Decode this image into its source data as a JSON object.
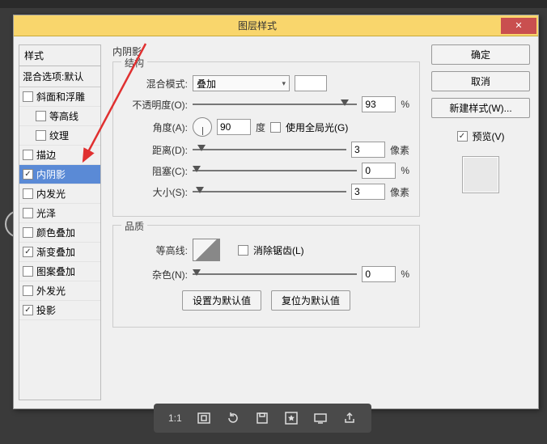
{
  "window": {
    "title": "图层样式"
  },
  "sidebar": {
    "header": "样式",
    "blend": "混合选项:默认",
    "items": [
      {
        "label": "斜面和浮雕",
        "checked": false,
        "indent": false
      },
      {
        "label": "等高线",
        "checked": false,
        "indent": true
      },
      {
        "label": "纹理",
        "checked": false,
        "indent": true
      },
      {
        "label": "描边",
        "checked": false,
        "indent": false
      },
      {
        "label": "内阴影",
        "checked": true,
        "indent": false,
        "selected": true
      },
      {
        "label": "内发光",
        "checked": false,
        "indent": false
      },
      {
        "label": "光泽",
        "checked": false,
        "indent": false
      },
      {
        "label": "颜色叠加",
        "checked": false,
        "indent": false
      },
      {
        "label": "渐变叠加",
        "checked": true,
        "indent": false
      },
      {
        "label": "图案叠加",
        "checked": false,
        "indent": false
      },
      {
        "label": "外发光",
        "checked": false,
        "indent": false
      },
      {
        "label": "投影",
        "checked": true,
        "indent": false
      }
    ]
  },
  "panel": {
    "title": "内阴影",
    "group_structure": "结构",
    "blend_mode_label": "混合模式:",
    "blend_mode_value": "叠加",
    "opacity_label": "不透明度(O):",
    "opacity_value": "93",
    "opacity_unit": "%",
    "angle_label": "角度(A):",
    "angle_value": "90",
    "angle_unit": "度",
    "use_global_light": "使用全局光(G)",
    "distance_label": "距离(D):",
    "distance_value": "3",
    "distance_unit": "像素",
    "choke_label": "阻塞(C):",
    "choke_value": "0",
    "choke_unit": "%",
    "size_label": "大小(S):",
    "size_value": "3",
    "size_unit": "像素",
    "group_quality": "品质",
    "contour_label": "等高线:",
    "antialias_label": "消除锯齿(L)",
    "noise_label": "杂色(N):",
    "noise_value": "0",
    "noise_unit": "%",
    "reset_default": "设置为默认值",
    "restore_default": "复位为默认值"
  },
  "buttons": {
    "ok": "确定",
    "cancel": "取消",
    "new_style": "新建样式(W)...",
    "preview": "预览(V)"
  },
  "bottombar": {
    "zoom": "1:1"
  }
}
